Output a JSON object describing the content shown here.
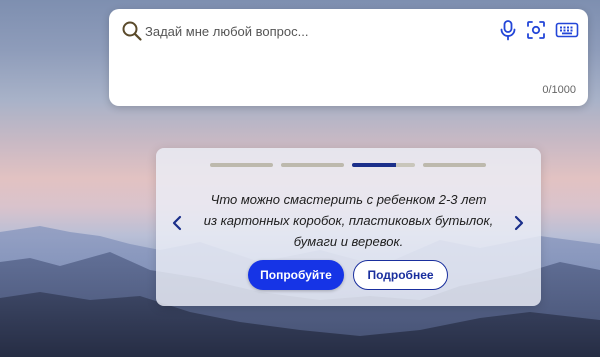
{
  "search": {
    "placeholder": "Задай мне любой вопрос...",
    "counter": "0/1000"
  },
  "icons": {
    "search": "search-icon",
    "mic": "microphone-icon",
    "camera": "visual-search-icon",
    "keyboard": "keyboard-icon",
    "prev": "chevron-left-icon",
    "next": "chevron-right-icon"
  },
  "colors": {
    "accent": "#1634e6",
    "accent_dark": "#1b2f8a"
  },
  "carousel": {
    "slide_count": 4,
    "active_index": 2,
    "lines": [
      "Что можно смастерить с ребенком 2-3 лет",
      "из картонных коробок, пластиковых бутылок,",
      "бумаги и веревок."
    ],
    "try_label": "Попробуйте",
    "more_label": "Подробнее"
  }
}
